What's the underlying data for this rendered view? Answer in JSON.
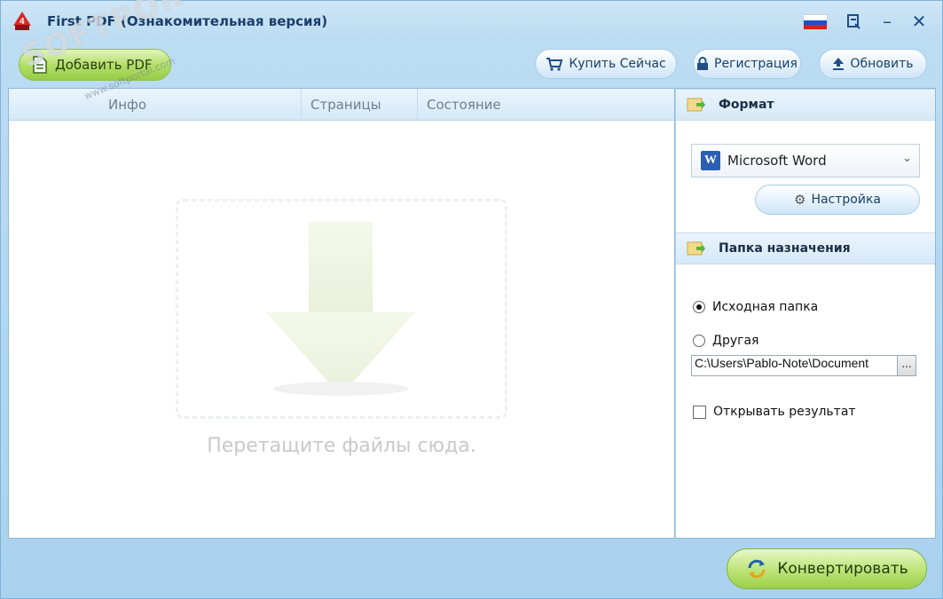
{
  "window": {
    "title": "First PDF (Ознакомительная версия)",
    "icons": [
      "app-logo-icon",
      "russian-flag-icon",
      "menu-icon",
      "minimize-icon",
      "close-icon"
    ]
  },
  "toolbar": {
    "add_pdf": "Добавить PDF",
    "buy_now": "Купить Сейчас",
    "register": "Регистрация",
    "update": "Обновить"
  },
  "list": {
    "columns": [
      "Инфо",
      "Страницы",
      "Состояние"
    ],
    "drop_hint": "Перетащите файлы сюда."
  },
  "format_panel": {
    "title": "Формат",
    "selected_format": "Microsoft Word",
    "word_icon_letter": "W",
    "settings": "Настройка"
  },
  "destination_panel": {
    "title": "Папка назначения",
    "option_source": "Исходная папка",
    "option_other": "Другая",
    "selected": "source",
    "path": "C:\\Users\\Pablo-Note\\Document",
    "browse": "...",
    "open_result": "Открывать результат",
    "open_result_checked": false
  },
  "actions": {
    "convert": "Конвертировать"
  },
  "watermark": {
    "text": "SOFTPORTAL",
    "url": "www.softportal.com"
  },
  "colors": {
    "accent_green": "#9cd04b",
    "title_blue": "#1c3e6b",
    "panel_blue": "#a9d2ef"
  }
}
